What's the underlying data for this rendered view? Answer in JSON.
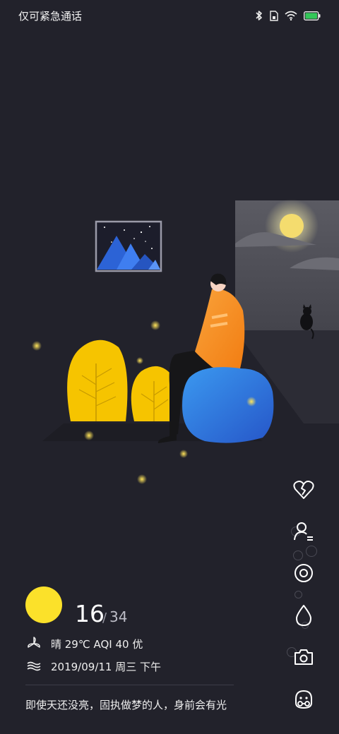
{
  "status_bar": {
    "carrier_text": "仅可紧急通话",
    "icons": [
      "bluetooth-icon",
      "sim-card-icon",
      "wifi-icon",
      "battery-icon"
    ],
    "battery_level": 1.0,
    "battery_color": "#34c759"
  },
  "wallpaper": {
    "scene": "night-room-illustration",
    "colors": {
      "background": "#22222b",
      "moon": "#f6e27a",
      "shirt": "#f7931e",
      "seat": "#2f7de1",
      "plants": "#f6c400",
      "painting": "#2c63d6"
    }
  },
  "weather": {
    "icon": "sun-icon",
    "current_temp": "16",
    "high_temp": "34",
    "condition": "晴 29℃ AQI 40 优",
    "date_line": "2019/09/11 周三 下午",
    "quote": "即使天还没亮，固执做梦的人，身前会有光",
    "condition_icon": "windmill-icon",
    "date_icon": "wave-icon",
    "accent_color": "#fbe12a"
  },
  "right_menu": {
    "items": [
      {
        "icon": "broken-heart-icon"
      },
      {
        "icon": "user-settings-icon"
      },
      {
        "icon": "target-icon"
      },
      {
        "icon": "water-drop-icon"
      },
      {
        "icon": "camera-icon"
      },
      {
        "icon": "mascot-face-icon"
      }
    ]
  }
}
